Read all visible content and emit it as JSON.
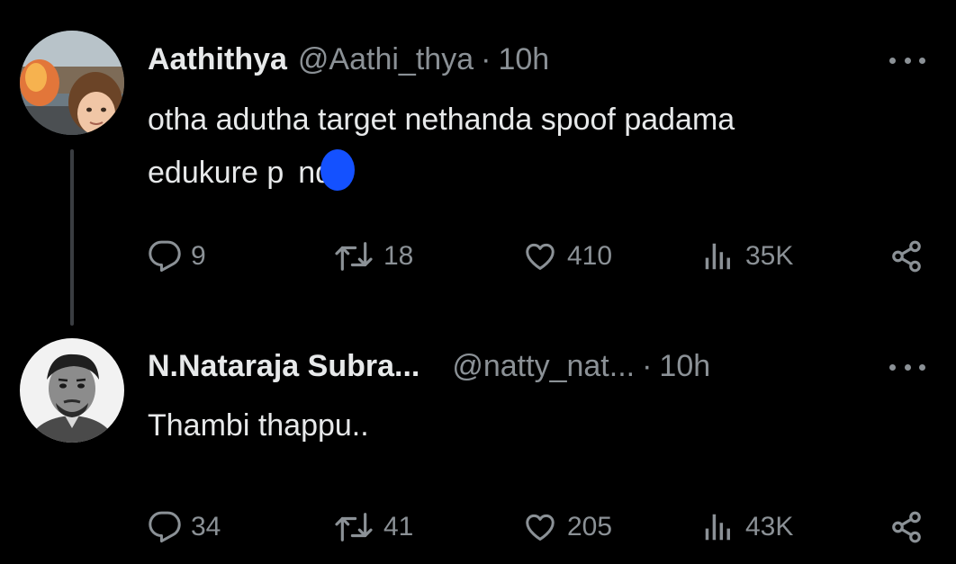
{
  "tweets": [
    {
      "display_name": "Aathithya",
      "handle": "@Aathi_thya",
      "separator": "·",
      "time": "10h",
      "text_lines": [
        "otha adutha target nethanda spoof padama",
        "edukure p",
        "nda"
      ],
      "stats": {
        "replies": "9",
        "retweets": "18",
        "likes": "410",
        "views": "35K"
      }
    },
    {
      "display_name": "N.Nataraja Subra...",
      "handle": "@natty_nat...",
      "separator": "·",
      "time": "10h",
      "text_lines": [
        "Thambi thappu.."
      ],
      "stats": {
        "replies": "34",
        "retweets": "41",
        "likes": "205",
        "views": "43K"
      }
    }
  ],
  "icons": [
    "reply-icon",
    "retweet-icon",
    "like-icon",
    "views-icon",
    "share-icon",
    "more-icon"
  ],
  "colors": {
    "background": "#000000",
    "text_primary": "#e7e9ea",
    "text_secondary": "#8b9196",
    "thread_line": "#3a3d41",
    "overlay_dot": "#1451ff"
  }
}
